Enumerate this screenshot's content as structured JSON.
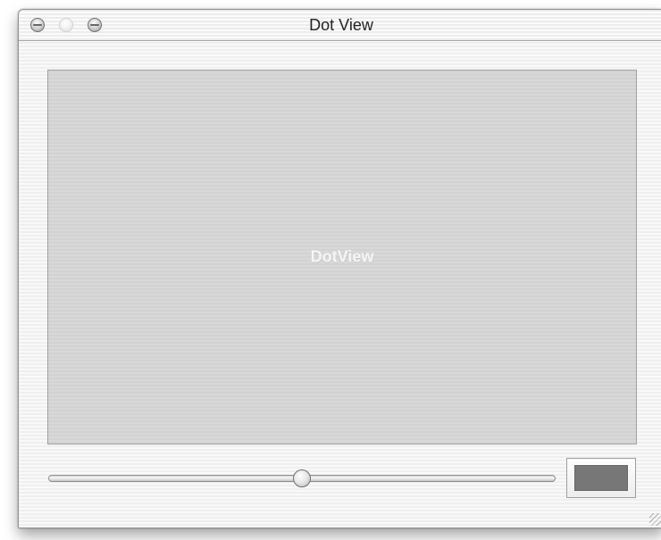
{
  "window": {
    "title": "Dot View"
  },
  "dotview": {
    "label": "DotView"
  },
  "controls": {
    "slider_value_fraction": 0.5,
    "color_well_color": "#777777"
  },
  "icons": {
    "close": "close-icon",
    "minimize": "minimize-icon",
    "zoom": "zoom-icon",
    "resize": "resize-grip-icon"
  }
}
